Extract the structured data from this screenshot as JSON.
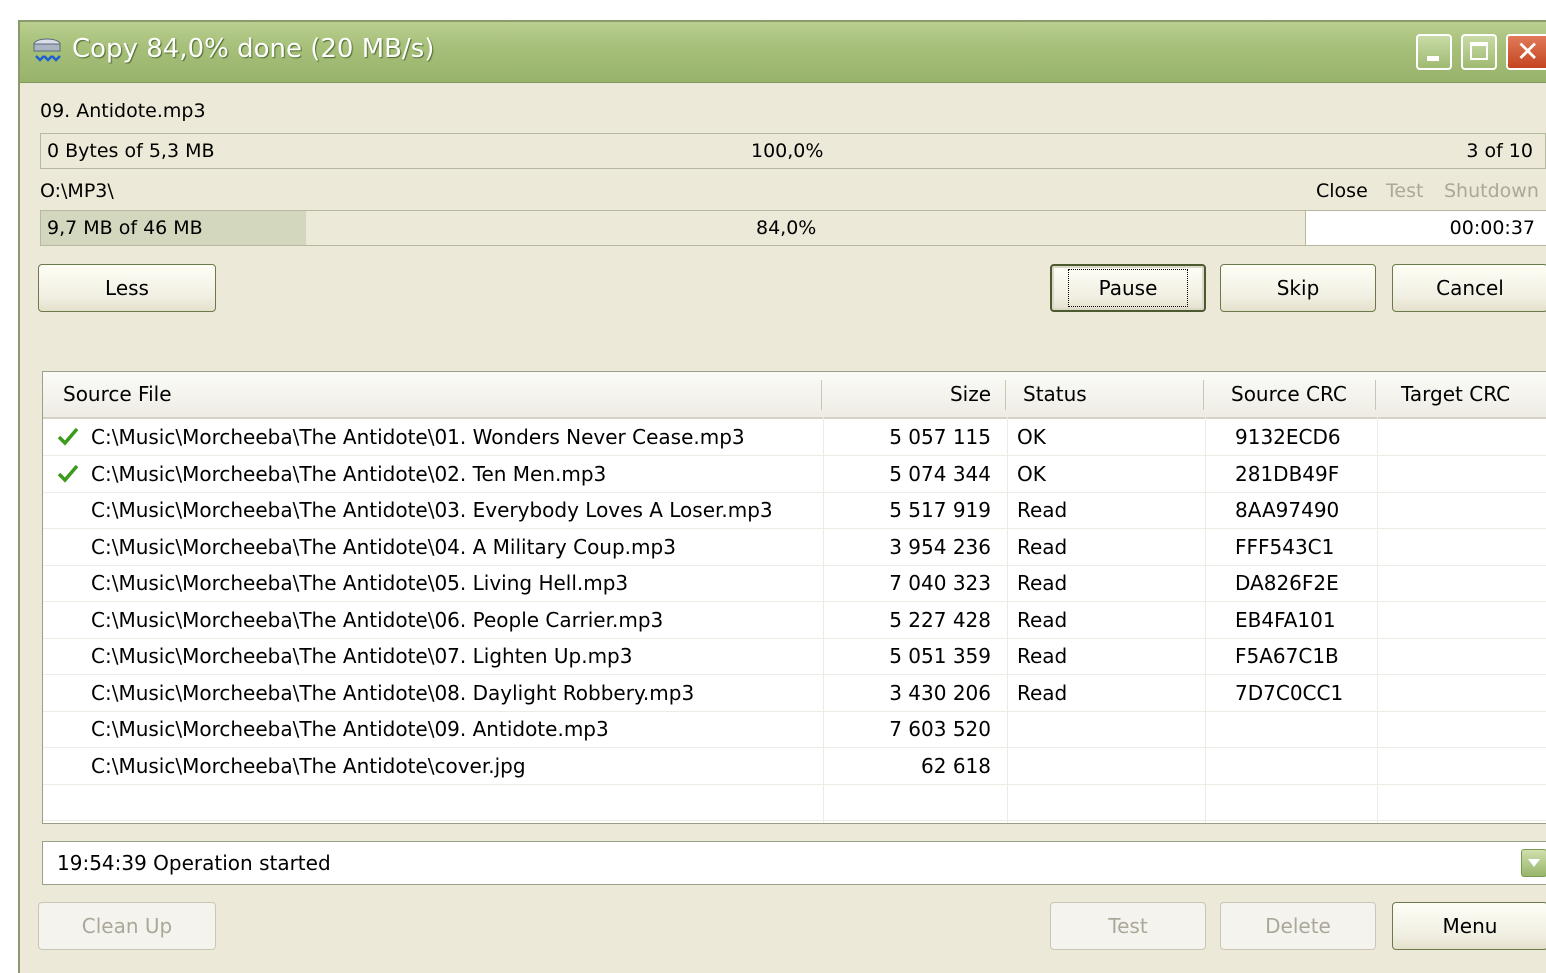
{
  "window": {
    "title": "Copy 84,0% done (20 MB/s)"
  },
  "current": {
    "file_name": "09. Antidote.mp3",
    "file_progress_text": "0 Bytes of 5,3 MB",
    "file_percent": "100,0%",
    "file_count": "3 of 10",
    "file_progress_fraction": 0.0,
    "target_path": "O:\\MP3\\",
    "total_progress_text": "9,7 MB of 46 MB",
    "total_percent": "84,0%",
    "total_progress_fraction": 0.21,
    "time_remaining": "00:00:37"
  },
  "after_options": {
    "close": "Close",
    "test": "Test",
    "shutdown": "Shutdown"
  },
  "buttons": {
    "less": "Less",
    "pause": "Pause",
    "skip": "Skip",
    "cancel": "Cancel",
    "clean_up": "Clean Up",
    "test": "Test",
    "delete": "Delete",
    "menu": "Menu"
  },
  "table": {
    "columns": {
      "source": "Source File",
      "size": "Size",
      "status": "Status",
      "source_crc": "Source CRC",
      "target_crc": "Target CRC"
    },
    "rows": [
      {
        "done": true,
        "source": "C:\\Music\\Morcheeba\\The Antidote\\01. Wonders Never Cease.mp3",
        "size": "5 057 115",
        "status": "OK",
        "source_crc": "9132ECD6",
        "target_crc": ""
      },
      {
        "done": true,
        "source": "C:\\Music\\Morcheeba\\The Antidote\\02. Ten Men.mp3",
        "size": "5 074 344",
        "status": "OK",
        "source_crc": "281DB49F",
        "target_crc": ""
      },
      {
        "done": false,
        "source": "C:\\Music\\Morcheeba\\The Antidote\\03. Everybody Loves A Loser.mp3",
        "size": "5 517 919",
        "status": "Read",
        "source_crc": "8AA97490",
        "target_crc": ""
      },
      {
        "done": false,
        "source": "C:\\Music\\Morcheeba\\The Antidote\\04. A Military Coup.mp3",
        "size": "3 954 236",
        "status": "Read",
        "source_crc": "FFF543C1",
        "target_crc": ""
      },
      {
        "done": false,
        "source": "C:\\Music\\Morcheeba\\The Antidote\\05. Living Hell.mp3",
        "size": "7 040 323",
        "status": "Read",
        "source_crc": "DA826F2E",
        "target_crc": ""
      },
      {
        "done": false,
        "source": "C:\\Music\\Morcheeba\\The Antidote\\06. People Carrier.mp3",
        "size": "5 227 428",
        "status": "Read",
        "source_crc": "EB4FA101",
        "target_crc": ""
      },
      {
        "done": false,
        "source": "C:\\Music\\Morcheeba\\The Antidote\\07. Lighten Up.mp3",
        "size": "5 051 359",
        "status": "Read",
        "source_crc": "F5A67C1B",
        "target_crc": ""
      },
      {
        "done": false,
        "source": "C:\\Music\\Morcheeba\\The Antidote\\08. Daylight Robbery.mp3",
        "size": "3 430 206",
        "status": "Read",
        "source_crc": "7D7C0CC1",
        "target_crc": ""
      },
      {
        "done": false,
        "source": "C:\\Music\\Morcheeba\\The Antidote\\09. Antidote.mp3",
        "size": "7 603 520",
        "status": "",
        "source_crc": "",
        "target_crc": ""
      },
      {
        "done": false,
        "source": "C:\\Music\\Morcheeba\\The Antidote\\cover.jpg",
        "size": "62 618",
        "status": "",
        "source_crc": "",
        "target_crc": ""
      }
    ]
  },
  "log": {
    "text": "19:54:39 Operation started"
  },
  "icons": {
    "app": "copy-drive-icon",
    "done": "check-icon",
    "dropdown": "chevron-down-icon"
  },
  "colors": {
    "titlebar": "#a7c07a",
    "progress_fill": "#d2d7bd",
    "check": "#3c9a1c",
    "disabled_text": "#aca899"
  }
}
